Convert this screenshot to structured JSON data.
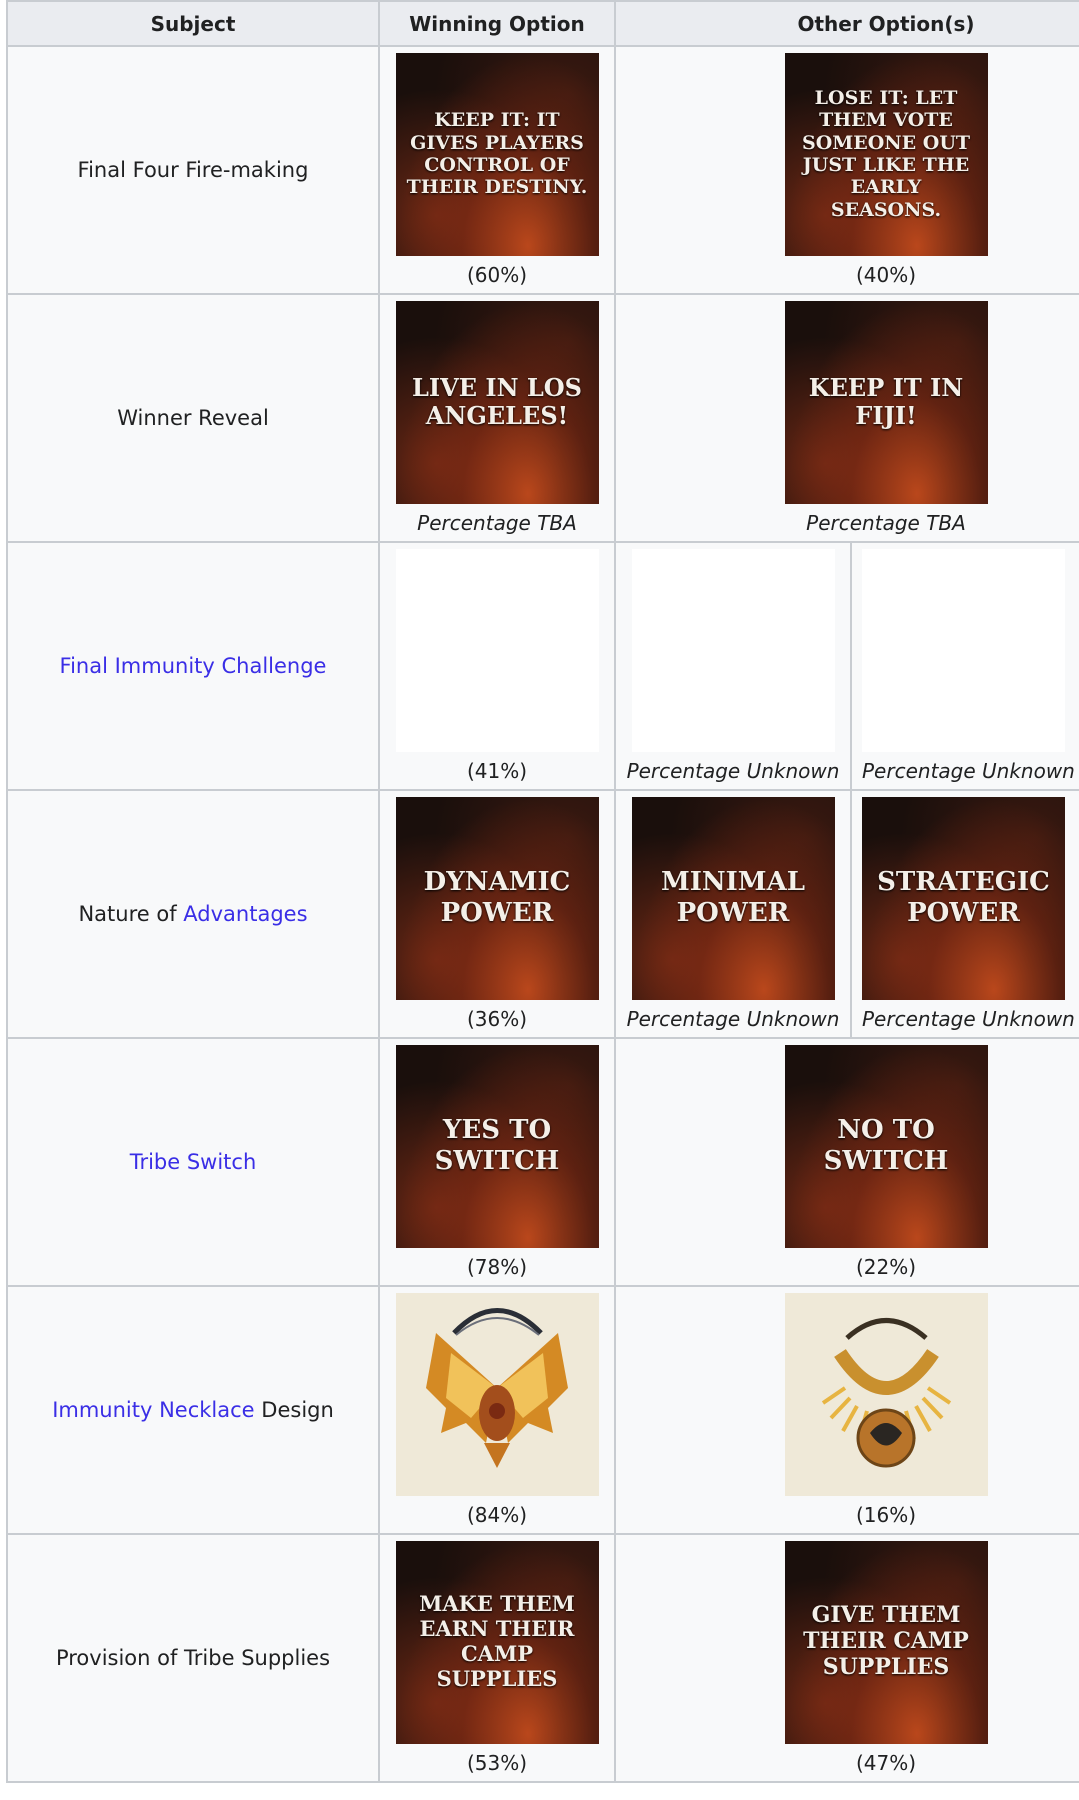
{
  "headers": [
    "Subject",
    "Winning Option",
    "Other Option(s)"
  ],
  "rows": [
    {
      "subject": "Final Four Fire-making",
      "winning": {
        "image_text": "KEEP IT: IT GIVES PLAYERS CONTROL OF THEIR DESTINY.",
        "percent": "(60%)"
      },
      "others": [
        {
          "image_text": "LOSE IT: LET THEM VOTE SOMEONE OUT JUST LIKE THE EARLY SEASONS.",
          "percent": "(40%)"
        }
      ]
    },
    {
      "subject": "Winner Reveal",
      "winning": {
        "image_text": "LIVE IN LOS ANGELES!",
        "percent": "Percentage TBA"
      },
      "others": [
        {
          "image_text": "KEEP IT IN FIJI!",
          "percent": "Percentage TBA"
        }
      ]
    },
    {
      "subject_link": "Final Immunity Challenge",
      "winning": {
        "image": "challenge-collage-1",
        "percent": "(41%)"
      },
      "others": [
        {
          "image": "challenge-collage-2",
          "percent": "Percentage Unknown"
        },
        {
          "image": "challenge-collage-3",
          "percent": "Percentage Unknown"
        }
      ]
    },
    {
      "subject": "Nature of ",
      "subject_link": "Advantages",
      "winning": {
        "image_text": "DYNAMIC POWER",
        "percent": "(36%)"
      },
      "others": [
        {
          "image_text": "MINIMAL POWER",
          "percent": "Percentage Unknown"
        },
        {
          "image_text": "STRATEGIC POWER",
          "percent": "Percentage Unknown"
        }
      ]
    },
    {
      "subject_link": "Tribe Switch",
      "winning": {
        "image_text": "YES TO SWITCH",
        "percent": "(78%)"
      },
      "others": [
        {
          "image_text": "NO TO SWITCH",
          "percent": "(22%)"
        }
      ]
    },
    {
      "subject_link": "Immunity Necklace",
      "subject": " Design",
      "winning": {
        "image": "eagle-necklace",
        "percent": "(84%)"
      },
      "others": [
        {
          "image": "sun-necklace",
          "percent": "(16%)"
        }
      ]
    },
    {
      "subject": "Provision of Tribe Supplies",
      "winning": {
        "image_text": "MAKE THEM EARN THEIR CAMP SUPPLIES",
        "percent": "(53%)"
      },
      "others": [
        {
          "image_text": "GIVE THEM THEIR CAMP SUPPLIES",
          "percent": "(47%)"
        }
      ]
    }
  ],
  "colors": {
    "link": "#3a2ee6",
    "header_bg": "#eaecf0",
    "border": "#c8ccd1",
    "cell_bg": "#f8f9fa"
  }
}
